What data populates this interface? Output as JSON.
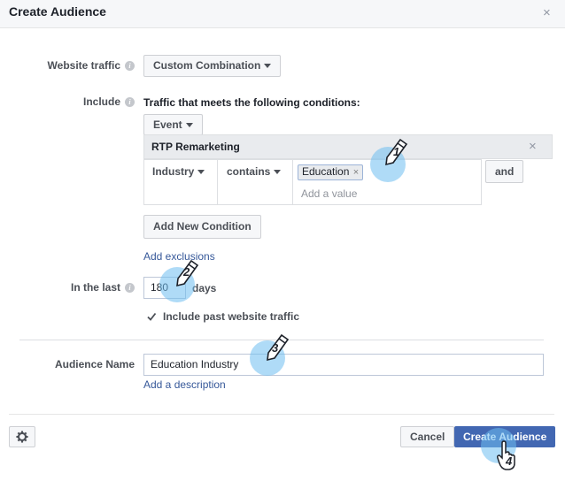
{
  "dialog": {
    "title": "Create Audience",
    "close_glyph": "×"
  },
  "website_traffic": {
    "label": "Website traffic",
    "selected": "Custom Combination"
  },
  "include": {
    "label": "Include",
    "description": "Traffic that meets the following conditions:",
    "event_label": "Event",
    "condition_group": {
      "title": "RTP Remarketing",
      "remove_glyph": "×",
      "field": "Industry",
      "operator": "contains",
      "value_token": "Education",
      "token_remove": "×",
      "value_placeholder": "Add a value",
      "and_label": "and"
    },
    "add_condition_label": "Add New Condition",
    "add_exclusions_label": "Add exclusions"
  },
  "in_the_last": {
    "label": "In the last",
    "value": "180",
    "unit": "days"
  },
  "include_past": {
    "label": "Include past website traffic",
    "checked": true
  },
  "audience_name": {
    "label": "Audience Name",
    "value": "Education Industry",
    "add_description": "Add a description"
  },
  "footer": {
    "cancel_label": "Cancel",
    "create_label": "Create Audience"
  },
  "steps": [
    "1",
    "2",
    "3",
    "4"
  ],
  "colors": {
    "primary": "#4267b2",
    "link": "#365899",
    "step_highlight": "#6ebef0"
  }
}
